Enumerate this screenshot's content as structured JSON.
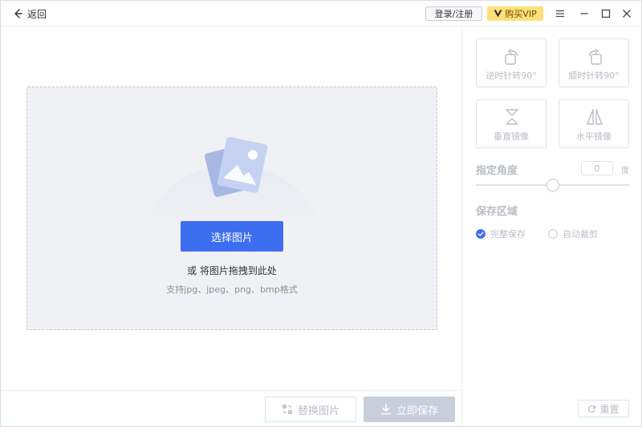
{
  "titlebar": {
    "back_label": "返回",
    "login_label": "登录/注册",
    "vip_label": "购买VIP",
    "icons": [
      "back-arrow-icon",
      "vip-logo-icon",
      "menu-icon",
      "minimize-icon",
      "maximize-icon",
      "close-icon"
    ]
  },
  "dropzone": {
    "select_label": "选择图片",
    "drag_hint": "或 将图片拖拽到此处",
    "formats": "支持jpg、jpeg、png、bmp格式"
  },
  "bottombar": {
    "replace_label": "替换图片",
    "save_label": "立即保存"
  },
  "panel": {
    "tools": [
      {
        "label": "逆时针转90°",
        "icon": "rotate-ccw-icon"
      },
      {
        "label": "顺时针转90°",
        "icon": "rotate-cw-icon"
      },
      {
        "label": "垂直镜像",
        "icon": "flip-vertical-icon"
      },
      {
        "label": "水平镜像",
        "icon": "flip-horizontal-icon"
      }
    ],
    "angle_label": "指定角度",
    "angle_value": "0",
    "angle_unit": "度",
    "angle_slider_fraction": 0.5,
    "save_area_label": "保存区域",
    "save_options": [
      {
        "label": "完整保存",
        "checked": true
      },
      {
        "label": "自动裁剪",
        "checked": false
      }
    ],
    "reset_label": "重置"
  },
  "colors": {
    "accent": "#3d6ef0",
    "vip": "#ffe07a",
    "disabled_text": "#b9bdc5",
    "dropzone_bg": "#f0f1f5"
  }
}
